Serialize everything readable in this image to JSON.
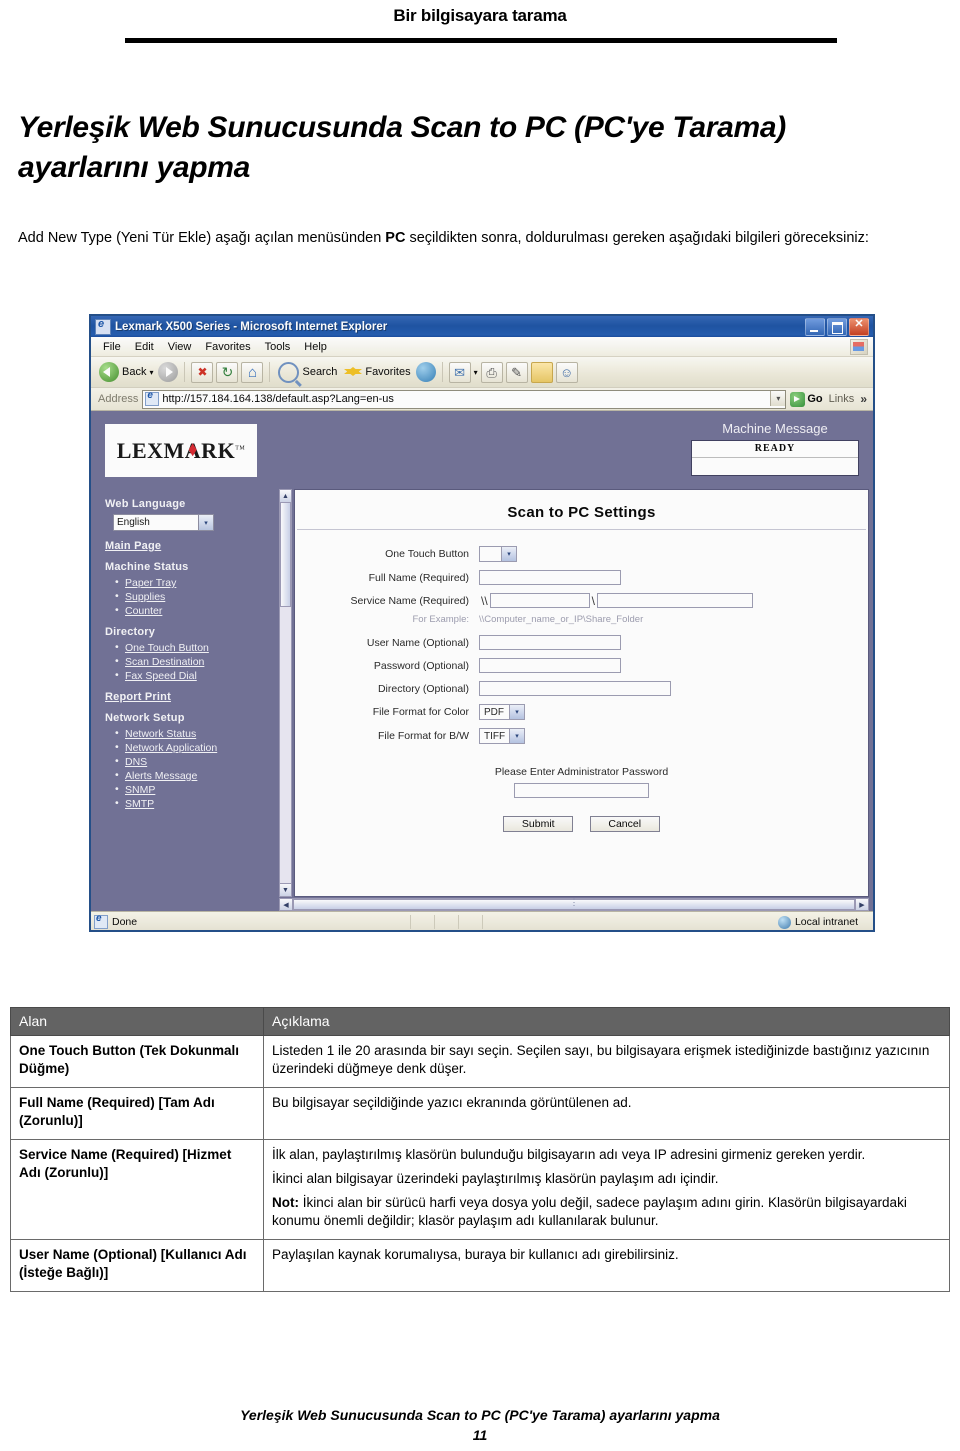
{
  "running_header": "Bir bilgisayara tarama",
  "page_title": "Yerleşik Web Sunucusunda Scan to PC (PC'ye Tarama) ayarlarını yapma",
  "intro": {
    "before": "Add New Type (Yeni Tür Ekle) aşağı açılan menüsünden ",
    "bold": "PC",
    "after": " seçildikten sonra, doldurulması gereken aşağıdaki bilgileri göreceksiniz:"
  },
  "browser": {
    "window_title": "Lexmark X500 Series - Microsoft Internet Explorer",
    "menu_items": [
      "File",
      "Edit",
      "View",
      "Favorites",
      "Tools",
      "Help"
    ],
    "toolbar": {
      "back": "Back",
      "search": "Search",
      "favorites": "Favorites"
    },
    "address": {
      "label": "Address",
      "url": "http://157.184.164.138/default.asp?Lang=en-us",
      "go": "Go",
      "links": "Links",
      "overflow": "»"
    },
    "status": {
      "text": "Done",
      "zone": "Local intranet"
    }
  },
  "webpage": {
    "logo": "LEXMARK",
    "logo_tm": "TM",
    "machine_message_title": "Machine Message",
    "machine_message_value": "READY",
    "sidebar": {
      "web_language_label": "Web Language",
      "web_language_value": "English",
      "main_page": "Main Page",
      "machine_status": "Machine Status",
      "machine_status_items": [
        "Paper Tray",
        "Supplies",
        "Counter"
      ],
      "directory": "Directory",
      "directory_items": [
        "One Touch Button",
        "Scan Destination",
        "Fax Speed Dial"
      ],
      "report_print": "Report Print",
      "network_setup": "Network Setup",
      "network_setup_items": [
        "Network Status",
        "Network Application",
        "DNS",
        "Alerts Message",
        "SNMP",
        "SMTP"
      ]
    },
    "settings": {
      "title": "Scan to PC Settings",
      "rows": [
        {
          "label": "One Touch Button",
          "value": ""
        },
        {
          "label": "Full Name (Required)",
          "value": ""
        },
        {
          "label": "Service Name (Required)",
          "value": ""
        },
        {
          "label": "User Name (Optional)",
          "value": ""
        },
        {
          "label": "Password (Optional)",
          "value": ""
        },
        {
          "label": "Directory (Optional)",
          "value": ""
        },
        {
          "label": "File Format for Color",
          "value": "PDF"
        },
        {
          "label": "File Format for B/W",
          "value": "TIFF"
        }
      ],
      "service_prefix": "\\\\",
      "service_separator": "\\",
      "example_label": "For Example:",
      "example_value": "\\\\Computer_name_or_IP\\Share_Folder",
      "admin_password_label": "Please Enter Administrator Password",
      "admin_password_value": "",
      "submit": "Submit",
      "cancel": "Cancel"
    }
  },
  "table": {
    "headers": [
      "Alan",
      "Açıklama"
    ],
    "rows": [
      {
        "field": "One Touch Button (Tek Dokunmalı Düğme)",
        "paragraphs": [
          {
            "text": "Listeden 1 ile 20 arasında bir sayı seçin. Seçilen sayı, bu bilgisayara erişmek istediğinizde bastığınız yazıcının üzerindeki düğmeye denk düşer."
          }
        ]
      },
      {
        "field": "Full Name (Required) [Tam Adı (Zorunlu)]",
        "paragraphs": [
          {
            "text": "Bu bilgisayar seçildiğinde yazıcı ekranında görüntülenen ad."
          }
        ]
      },
      {
        "field": "Service Name (Required) [Hizmet Adı (Zorunlu)]",
        "paragraphs": [
          {
            "text": "İlk alan, paylaştırılmış klasörün bulunduğu bilgisayarın adı veya IP adresini girmeniz gereken yerdir."
          },
          {
            "text": "İkinci alan bilgisayar üzerindeki paylaştırılmış klasörün paylaşım adı içindir."
          },
          {
            "bold": "Not:",
            "text": " İkinci alan bir sürücü harfi veya dosya yolu değil, sadece paylaşım adını girin. Klasörün bilgisayardaki konumu önemli değildir; klasör paylaşım adı kullanılarak bulunur."
          }
        ]
      },
      {
        "field": "User Name (Optional) [Kullanıcı Adı (İsteğe Bağlı)]",
        "paragraphs": [
          {
            "text": "Paylaşılan kaynak korumalıysa, buraya bir kullanıcı adı girebilirsiniz."
          }
        ]
      }
    ]
  },
  "footer": {
    "text": "Yerleşik Web Sunucusunda Scan to PC (PC'ye Tarama) ayarlarını yapma",
    "page_number": "11"
  }
}
